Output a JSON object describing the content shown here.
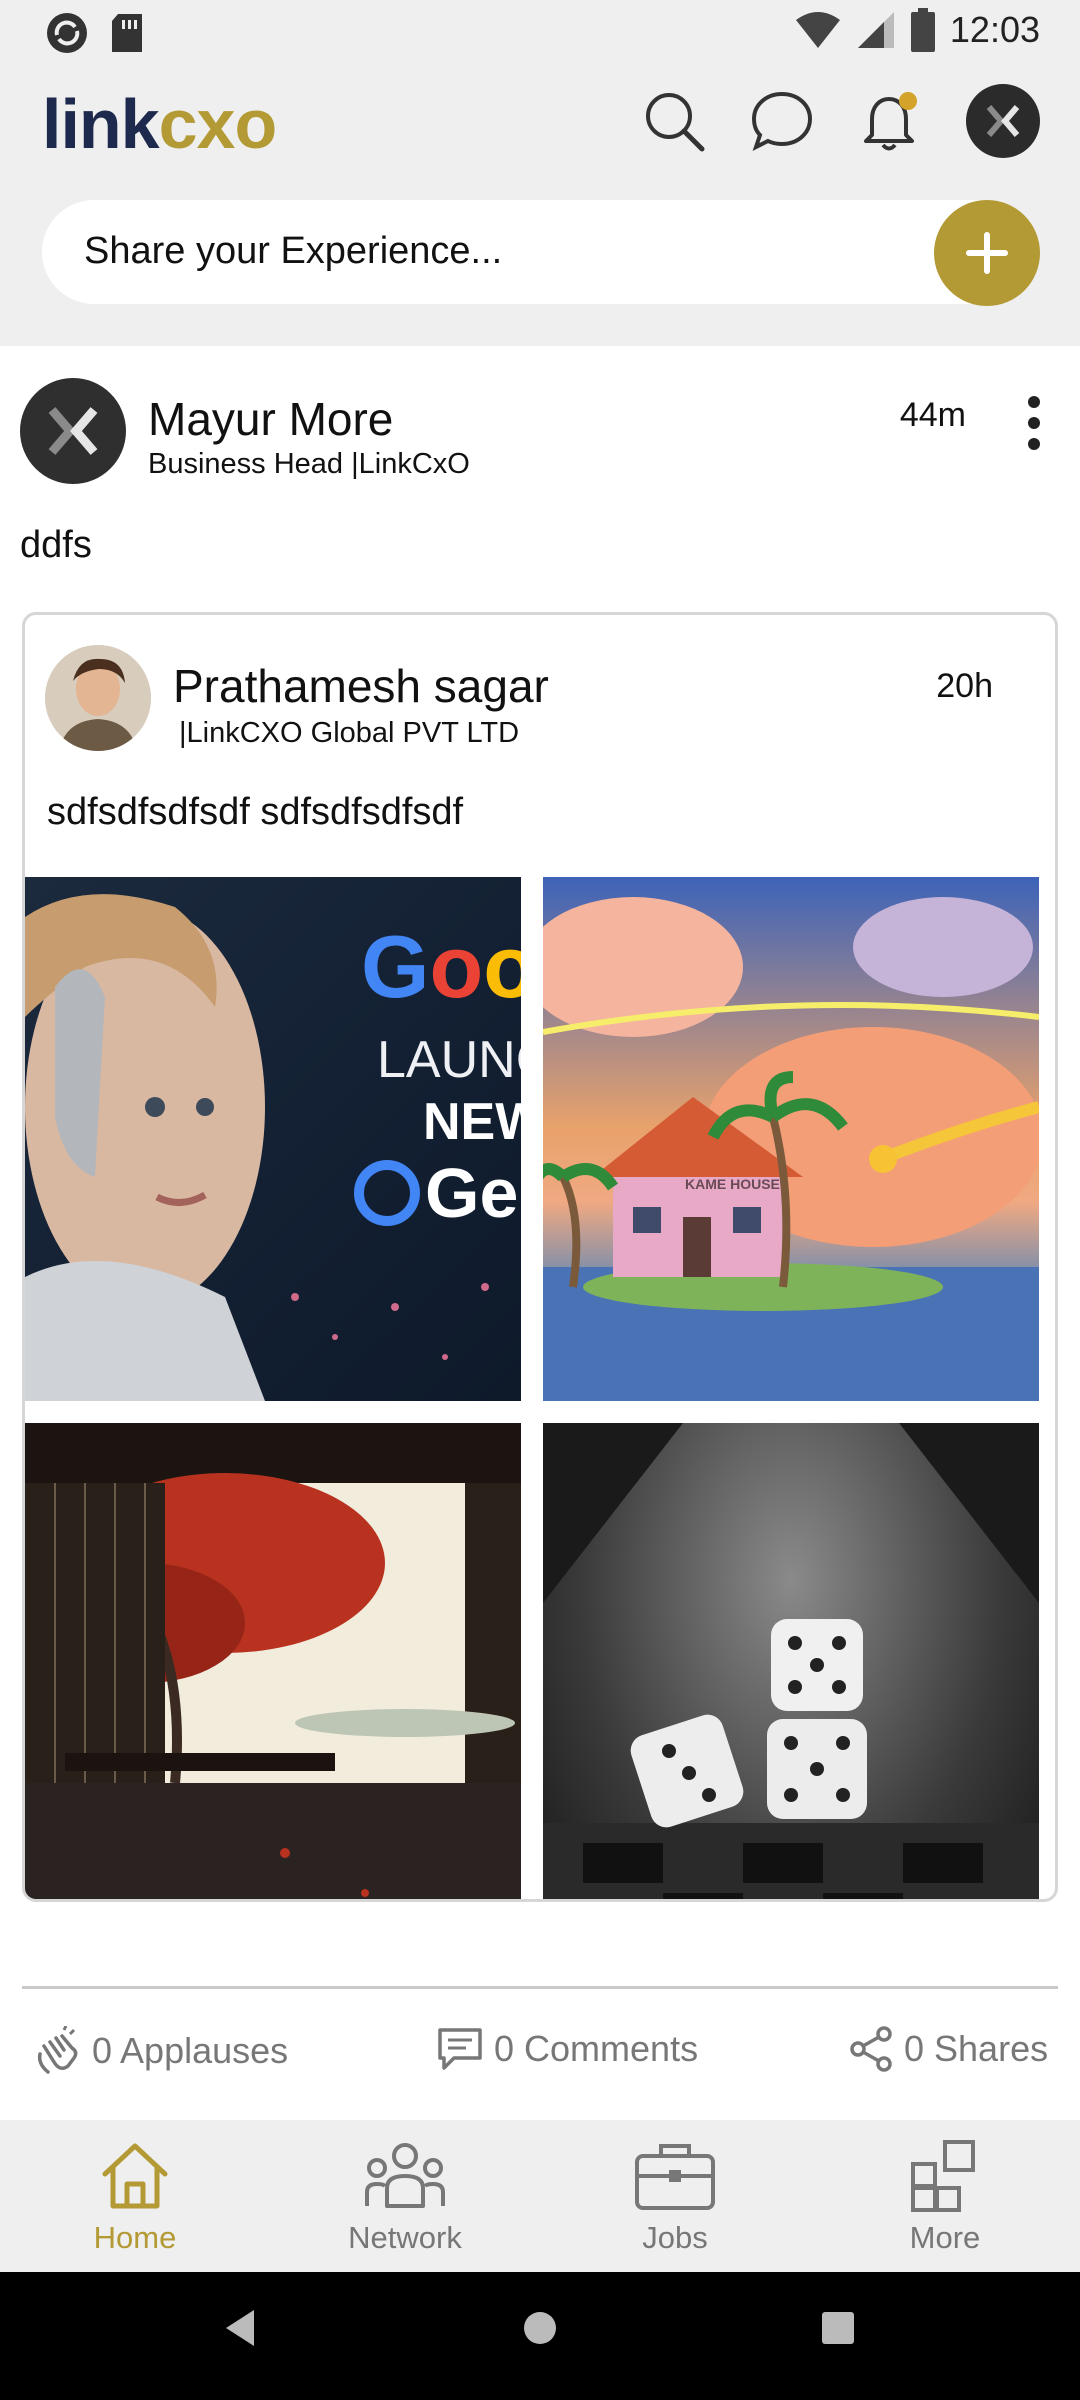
{
  "status_bar": {
    "time": "12:03"
  },
  "header": {
    "logo_link": "link",
    "logo_cxo": "cxo",
    "icons": [
      "search-icon",
      "chat-icon",
      "bell-icon",
      "avatar"
    ],
    "notification_dot_color": "#d4a42a"
  },
  "share": {
    "placeholder": "Share your Experience..."
  },
  "post": {
    "author": "Mayur More",
    "subtitle": "Business Head |LinkCxO",
    "time": "44m",
    "text": "ddfs",
    "shared": {
      "author": "Prathamesh sagar",
      "subtitle": "|LinkCXO Global PVT LTD",
      "time": "20h",
      "text": "sdfsdfsdfsdf sdfsdfsdfsdf",
      "images": [
        "google-launch-image",
        "island-house-image",
        "autumn-room-image",
        "dice-image"
      ],
      "image_text": {
        "goo": "Goo",
        "launc": "LAUNC",
        "new": "NEW",
        "ge": "Ge",
        "kame": "KAME HOUSE"
      }
    },
    "applauses": "0 Applauses",
    "comments": "0 Comments",
    "shares": "0 Shares"
  },
  "bottom_nav": {
    "home": "Home",
    "network": "Network",
    "jobs": "Jobs",
    "more": "More"
  },
  "colors": {
    "accent": "#b39a35",
    "logo_dark": "#1d2a4d"
  }
}
